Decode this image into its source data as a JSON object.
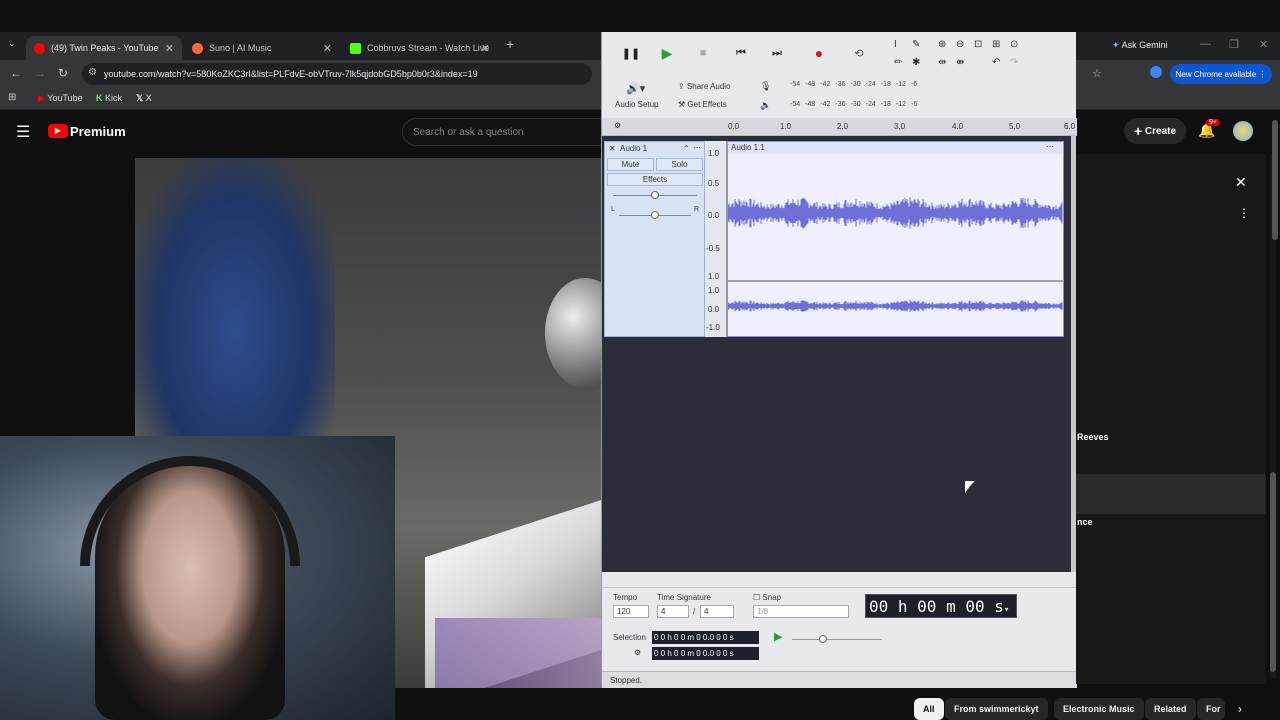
{
  "browser": {
    "tabs": [
      {
        "title": "(49) Twin Peaks - YouTube",
        "favicon_color": "#ff0000"
      },
      {
        "title": "Suno | AI Music",
        "favicon_color": "#ff6a3d"
      },
      {
        "title": "Cobbruvs Stream - Watch Live",
        "favicon_color": "#53fc18"
      }
    ],
    "url": "youtube.com/watch?v=580KoZKC3rI&list=PLFdvE-obVTruv-7lk5qjdobGD5bp0b0r3&index=19",
    "bookmarks": [
      "YouTube",
      "Kick",
      "X"
    ],
    "ask_gemini": "Ask Gemini",
    "new_chrome": "New Chrome available"
  },
  "youtube": {
    "logo_text": "Premium",
    "search_placeholder": "Search or ask a question",
    "create_label": "Create",
    "notif_badge": "9+",
    "side_texts": [
      "Reeves",
      "nce"
    ],
    "chips": [
      "All",
      "From swimmerickyt",
      "Electronic Music",
      "Related",
      "For"
    ]
  },
  "audacity": {
    "toolbar": {
      "audio_setup": "Audio Setup",
      "share_audio": "Share Audio",
      "get_effects": "Get Effects",
      "meter_scale": [
        "-54",
        "-48",
        "-42",
        "-36",
        "-30",
        "-24",
        "-18",
        "-12",
        "-6"
      ]
    },
    "ruler": [
      "0.0",
      "1.0",
      "2.0",
      "3.0",
      "4.0",
      "5.0",
      "6.0"
    ],
    "track": {
      "name": "Audio 1",
      "mute": "Mute",
      "solo": "Solo",
      "effects": "Effects",
      "pan_left": "L",
      "pan_right": "R",
      "clip_name": "Audio 1.1",
      "scale_top": [
        "1.0",
        "0.5",
        "0.0",
        "-0.5",
        "-1.0"
      ],
      "scale_bottom": [
        "1.0",
        "0.0",
        "-1.0"
      ]
    },
    "bottom": {
      "tempo_label": "Tempo",
      "tempo_value": "120",
      "time_sig_label": "Time Signature",
      "time_sig_num": "4",
      "time_sig_den": "4",
      "snap_label": "Snap",
      "snap_value": "1/8",
      "big_time": "00 h 00 m 00 s",
      "selection_label": "Selection",
      "sel_start": "0 0 h 0 0 m 0 0.0 0 0 s",
      "sel_end": "0 0 h 0 0 m 0 0.0 0 0 s",
      "status": "Stopped."
    }
  }
}
